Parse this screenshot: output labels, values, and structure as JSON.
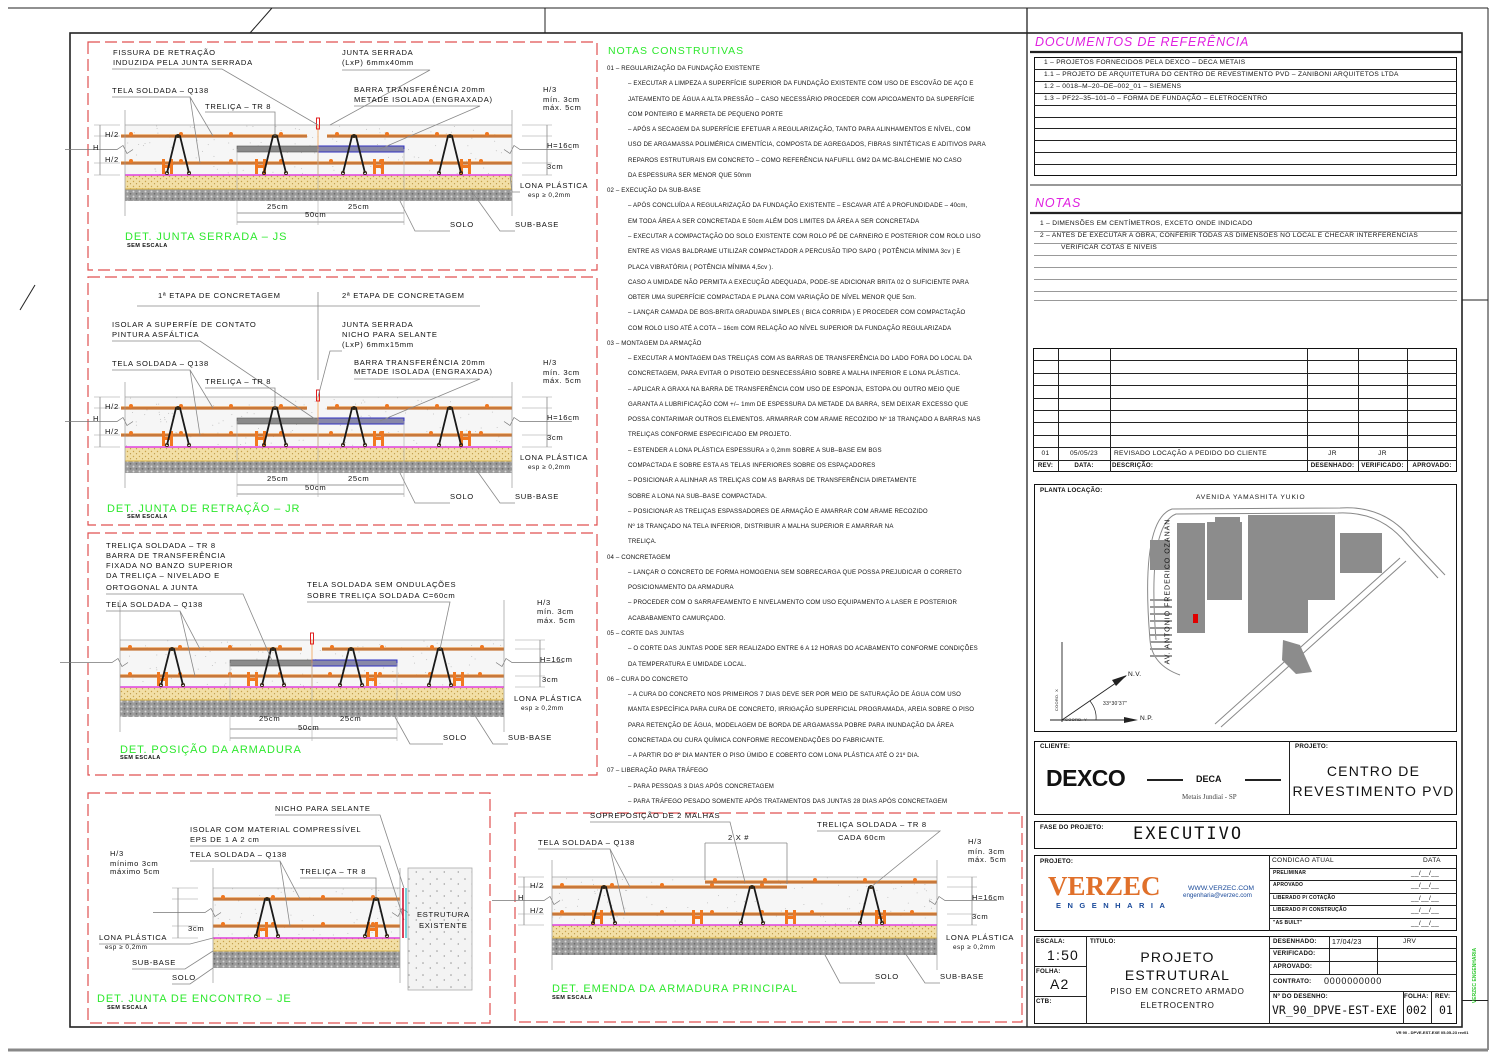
{
  "colors": {
    "detail_title": "#2ee82e",
    "frame_dashed": "#e05050",
    "heading_magenta": "#e020e0",
    "rebar": "#c8783a",
    "spacer": "#f07820",
    "lona": "#e040e0",
    "transfer_bar_half": "#5a5ab8",
    "verzec_orange": "#e0702a",
    "verzec_blue": "#1a4a9a",
    "location_marker": "#e00000"
  },
  "details": {
    "js": {
      "title": "DET. JUNTA SERRADA – JS",
      "scale": "SEM ESCALA",
      "labels": [
        "FISSURA DE RETRAÇÃO",
        "INDUZIDA PELA JUNTA SERRADA",
        "JUNTA SERRADA",
        "(LxP) 6mmx40mm",
        "TELA SOLDADA – Q138",
        "TRELIÇA – TR 8",
        "BARRA TRANSFERÊNCIA 20mm",
        "METADE ISOLADA (ENGRAXADA)",
        "H/3",
        "mín. 3cm",
        "máx. 5cm",
        "H/2",
        "H",
        "H/2",
        "H=16cm",
        "3cm",
        "LONA PLÁSTICA",
        "esp ≥ 0,2mm",
        "25cm",
        "25cm",
        "50cm",
        "SOLO",
        "SUB-BASE"
      ]
    },
    "jr": {
      "title": "DET. JUNTA DE RETRAÇÃO – JR",
      "scale": "SEM ESCALA",
      "labels": [
        "1ª ETAPA DE CONCRETAGEM",
        "2ª ETAPA DE CONCRETAGEM",
        "ISOLAR A SUPERFÍE DE CONTATO",
        "PINTURA ASFÁLTICA",
        "JUNTA SERRADA",
        "NICHO PARA SELANTE",
        "(LxP) 6mmx15mm",
        "TELA SOLDADA – Q138",
        "TRELIÇA – TR 8",
        "BARRA TRANSFERÊNCIA 20mm",
        "METADE ISOLADA (ENGRAXADA)",
        "H/3",
        "mín. 3cm",
        "máx. 5cm",
        "H/2",
        "H",
        "H/2",
        "H=16cm",
        "3cm",
        "LONA PLÁSTICA",
        "esp ≥ 0,2mm",
        "25cm",
        "25cm",
        "50cm",
        "SOLO",
        "SUB-BASE"
      ]
    },
    "pos": {
      "title": "DET. POSIÇÃO DA ARMADURA",
      "scale": "SEM ESCALA",
      "labels": [
        "TRELIÇA SOLDADA – TR 8",
        "BARRA DE TRANSFERÊNCIA",
        "FIXADA NO BANZO SUPERIOR",
        "DA TRELIÇA – NIVELADO E",
        "ORTOGONAL A JUNTA",
        "TELA SOLDADA SEM ONDULAÇÕES",
        "SOBRE TRELIÇA SOLDADA C=60cm",
        "TELA SOLDADA – Q138",
        "H/3",
        "mín. 3cm",
        "máx. 5cm",
        "H=16cm",
        "3cm",
        "LONA PLÁSTICA",
        "esp ≥ 0,2mm",
        "25cm",
        "25cm",
        "50cm",
        "SOLO",
        "SUB-BASE"
      ]
    },
    "je": {
      "title": "DET. JUNTA DE ENCONTRO – JE",
      "scale": "SEM ESCALA",
      "labels": [
        "NICHO PARA SELANTE",
        "ISOLAR COM MATERIAL COMPRESSÍVEL",
        "EPS DE 1 A 2 cm",
        "TELA SOLDADA – Q138",
        "TRELIÇA – TR 8",
        "H/3",
        "mínimo 3cm",
        "máximo 5cm",
        "3cm",
        "LONA PLÁSTICA",
        "esp ≥ 0,2mm",
        "SUB-BASE",
        "SOLO",
        "ESTRUTURA",
        "EXISTENTE"
      ]
    },
    "em": {
      "title": "DET. EMENDA DA ARMADURA PRINCIPAL",
      "scale": "SEM ESCALA",
      "labels": [
        "SOPREPOSIÇÃO DE 2 MALHAS",
        "2 X #",
        "TRELIÇA SOLDADA – TR 8",
        "CADA 60cm",
        "TELA SOLDADA – Q138",
        "H/3",
        "mín. 3cm",
        "máx. 5cm",
        "H/2",
        "H",
        "H/2",
        "H=16cm",
        "3cm",
        "LONA PLÁSTICA",
        "esp ≥ 0,2mm",
        "SOLO",
        "SUB-BASE"
      ]
    }
  },
  "notes": {
    "title": "NOTAS CONSTRUTIVAS",
    "sections": [
      {
        "heading": "01 – REGULARIZAÇÃO DA FUNDAÇÃO EXISTENTE",
        "lines": [
          "– EXECUTAR A LIMPEZA A SUPERFÍCIE SUPERIOR DA FUNDAÇÃO EXISTENTE COM USO DE ESCOVÃO DE AÇO E",
          "JATEAMENTO DE ÁGUA A ALTA PRESSÃO – CASO NECESSÁRIO PROCEDER COM APICOAMENTO DA SUPERFÍCIE",
          "COM PONTEIRO E MARRETA DE PEQUENO PORTE",
          "– APÓS A SECAGEM DA SUPERFÍCIE EFETUAR A REGULARIZAÇÃO, TANTO PARA ALINHAMENTOS E NÍVEL, COM",
          "USO DE ARGAMASSA POLIMÉRICA CIMENTÍCIA, COMPOSTA DE AGREGADOS, FIBRAS SINTÉTICAS E ADITIVOS PARA",
          "REPAROS ESTRUTURAIS EM CONCRETO –  COMO REFERÊNCIA NAFUFILL GM2 DA MC-BALCHEMIE NO CASO",
          "DA ESPESSURA SER MENOR QUE 50mm"
        ]
      },
      {
        "heading": "02 – EXECUÇÃO DA SUB-BASE",
        "lines": [
          "– APÓS CONCLUÍDA A REGULARIZAÇÃO DA FUNDAÇÃO EXISTENTE – ESCAVAR ATÉ A PROFUNDIDADE – 40cm,",
          "  EM TODA ÁREA A SER CONCRETADA E 50cm ALÉM DOS LIMITES DA ÁREA A SER CONCRETADA",
          "– EXECUTAR A COMPACTAÇÃO DO SOLO EXISTENTE COM ROLO PÉ DE CARNEIRO E POSTERIOR COM ROLO LISO",
          "ENTRE AS VIGAS BALDRAME UTILIZAR COMPACTADOR  A PERCUSÃO TIPO SAPO ( POTÊNCIA MÍNIMA 3cv ) E",
          "PLACA VIBRATÓRIA ( POTÊNCIA MÍNIMA 4,5cv ).",
          "CASO A UMIDADE NÃO PERMITA A EXECUÇÃO ADEQUADA, PODE-SE ADICIONAR BRITA 02 O SUFICIENTE PARA",
          "OBTER UMA SUPERFÍCIE COMPACTADA E PLANA COM VARIAÇÃO DE NÍVEL MENOR QUE 5cm.",
          "– LANÇAR CAMADA DE BGS-BRITA GRADUADA SIMPLES ( BICA CORRIDA ) E PROCEDER COM COMPACTAÇÃO",
          "COM ROLO LISO ATÉ A COTA – 16cm COM RELAÇÃO AO NÍVEL SUPERIOR DA FUNDAÇÃO REGULARIZADA"
        ]
      },
      {
        "heading": "03 – MONTAGEM DA ARMAÇÃO",
        "lines": [
          "– EXECUTAR A MONTAGEM DAS TRELIÇAS COM AS BARRAS DE TRANSFERÊNCIA DO LADO FORA DO LOCAL DA",
          "CONCRETAGEM, PARA EVITAR O PISOTEIO DESNECESSÁRIO SOBRE A MALHA INFERIOR E LONA PLÁSTICA.",
          "– APLICAR A GRAXA NA BARRA DE TRANSFERÊNCIA COM USO DE ESPONJA, ESTOPA OU OUTRO MEIO QUE",
          "GARANTA A LUBRIFICAÇÃO COM +/– 1mm DE ESPESSURA DA METADE DA BARRA, SEM DEIXAR EXCESSO QUE",
          "POSSA CONTARIMAR OUTROS ELEMENTOS. ARMARRAR COM ARAME RECOZIDO Nº 18 TRANÇADO A BARRAS NAS",
          "TRELIÇAS CONFORME ESPECIFICADO EM PROJETO.",
          "–  ESTENDER A LONA PLÁSTICA ESPESSURA ≥ 0,2mm SOBRE A SUB–BASE EM BGS",
          "COMPACTADA E SOBRE ESTA AS TELAS INFERIORES SOBRE OS ESPAÇADORES",
          "–  POSICIONAR A ALINHAR AS TRELIÇAS COM AS BARRAS DE TRANSFERÊNCIA DIRETAMENTE",
          "SOBRE A LONA NA SUB–BASE COMPACTADA.",
          "–  POSICIONAR AS TRELIÇAS ESPASSADORES DE ARMAÇÃO E AMARRAR COM ARAME RECOZIDO",
          "Nº 18 TRANÇADO NA TELA INFERIOR, DISTRIBUIR A MALHA SUPERIOR E AMARRAR NA",
          "TRELIÇA."
        ]
      },
      {
        "heading": "04 – CONCRETAGEM",
        "lines": [
          "– LANÇAR O CONCRETO DE FORMA HOMOGENIA SEM SOBRECARGA QUE POSSA PREJUDICAR  O CORRETO",
          "POSICIONAMENTO DA ARMADURA",
          "– PROCEDER COM O SARRAFEAMENTO E NIVELAMENTO COM USO EQUIPAMENTO A LASER E POSTERIOR",
          "ACABABAMENTO CAMURÇADO."
        ]
      },
      {
        "heading": "05 – CORTE DAS JUNTAS",
        "lines": [
          "– O CORTE DAS JUNTAS PODE SER REALIZADO ENTRE 6 A 12 HORAS DO ACABAMENTO CONFORME CONDIÇÕES",
          "DA TEMPERATURA E UMIDADE LOCAL."
        ]
      },
      {
        "heading": "06 – CURA DO CONCRETO",
        "lines": [
          "– A CURA DO CONCRETO NOS PRIMEIROS 7 DIAS DEVE SER POR MEIO DE SATURAÇÃO DE ÁGUA COM USO",
          "MANTA ESPECÍFICA PARA CURA DE CONCRETO, IRRIGAÇÃO SUPERFICIAL PROGRAMADA, AREIA SOBRE O PISO",
          "PARA RETENÇÃO DE ÁGUA, MODELAGEM DE BORDA DE ARGAMASSA POBRE PARA INUNDAÇÃO DA ÁREA",
          "CONCRETADA OU CURA QUÍMICA CONFORME RECOMENDAÇÕES DO FABRICANTE.",
          "– A PARTIR DO 8º DIA MANTER O PISO ÚMIDO E COBERTO COM LONA PLÁSTICA ATÉ O 21º DIA."
        ]
      },
      {
        "heading": "07 – LIBERAÇÃO PARA TRÁFEGO",
        "lines": [
          "– PARA PESSOAS 3 DIAS APÓS CONCRETAGEM",
          "– PARA TRÁFEGO PESADO SOMENTE APÓS TRATAMENTOS DAS JUNTAS 28 DIAS APÓS CONCRETAGEM"
        ]
      }
    ]
  },
  "references": {
    "title": "DOCUMENTOS DE REFERÊNCIA",
    "rows": [
      "1 – PROJETOS FORNECIDOS PELA DEXCO – DECA METAIS",
      "1.1 – PROJETO DE ARQUITETURA DO CENTRO DE REVESTIMENTO PVD – ZANIBONI ARQUITETOS LTDA",
      "1.2 – 0018–M–20–DE–002_01 – SIEMENS",
      "1.3 – PF22–35–101–0 – FORMA DE FUNDAÇÃO – ELETROCENTRO"
    ]
  },
  "general_notes": {
    "title": "NOTAS",
    "rows": [
      "1 – DIMENSÕES EM CENTÍMETROS, EXCETO ONDE INDICADO",
      "2 – ANTES DE EXECUTAR A OBRA, CONFERIR TODAS AS DIMENSÕES NO LOCAL E CHECAR INTERFERÊNCIAS",
      "VERIFICAR COTAS E NÍVEIS"
    ]
  },
  "revisions": {
    "headers": [
      "REV:",
      "DATA:",
      "DESCRIÇÃO:",
      "DESENHADO:",
      "VERIFICADO:",
      "APROVADO:"
    ],
    "rows": [
      [
        "01",
        "05/05/23",
        "REVISADO LOCAÇÃO A PEDIDO DO CLIENTE",
        "JR",
        "JR",
        ""
      ]
    ]
  },
  "location_plan": {
    "label": "PLANTA LOCAÇÃO:",
    "street_top": "AVENIDA YAMASHITA YUKIO",
    "street_left": "AV. ANTONIO FREDERICO OZANAN",
    "north_true": "N.V.",
    "north_project": "N.P.",
    "angle": "33°30'37\"",
    "coord_x": "COORD. X",
    "coord_y": "COORD. Y"
  },
  "title_block": {
    "client_label": "CLIENTE:",
    "client_logo": "DEXCO",
    "client_brand": "DECA",
    "client_site": "Metais Jundiaí - SP",
    "project_label": "PROJETO:",
    "project_name_1": "CENTRO DE",
    "project_name_2": "REVESTIMENTO PVD",
    "phase_label": "FASE DO PROJETO:",
    "phase": "EXECUTIVO",
    "designer_label": "PROJETO:",
    "designer_logo": "VERZEC",
    "designer_sub": "ENGENHARIA",
    "designer_web": "WWW.VERZEC.COM",
    "designer_email": "engenharia@verzec.com",
    "status_header": "CONDICAO ATUAL",
    "status_date_header": "DATA",
    "status_rows": [
      {
        "label": "PRELIMINAR",
        "date": "__/__/__"
      },
      {
        "label": "APROVADO",
        "date": "__/__/__"
      },
      {
        "label": "LIBERADO P/ COTAÇÃO",
        "date": "__/__/__"
      },
      {
        "label": "LIBERADO P/ CONSTRUÇÃO",
        "date": "__/__/__"
      },
      {
        "label": "\"AS BUILT\"",
        "date": "__/__/__"
      }
    ],
    "scale_label": "ESCALA:",
    "scale": "1:50",
    "sheet_label": "FOLHA:",
    "sheet": "A2",
    "ctb_label": "CTB:",
    "title_label": "TITULO:",
    "title_1": "PROJETO",
    "title_2": "ESTRUTURAL",
    "title_3": "PISO EM CONCRETO ARMADO",
    "title_4": "ELETROCENTRO",
    "drawn_label": "DESENHADO:",
    "drawn_date": "17/04/23",
    "drawn_by": "JRV",
    "checked_label": "VERIFICADO:",
    "approved_label": "APROVADO:",
    "contract_label": "CONTRATO:",
    "contract": "0000000000",
    "drawing_no_label": "Nº DO DESENHO:",
    "drawing_no": "VR_90_DPVE-EST-EXE",
    "folha_label": "FOLHA:",
    "folha": "002",
    "rev_label": "REV:",
    "rev": "01",
    "side_stamp": "VERZEC ENGENHARIA",
    "file_stamp": "VR 90 - DPVE-EST-EXE 05-05-23 rev01"
  }
}
